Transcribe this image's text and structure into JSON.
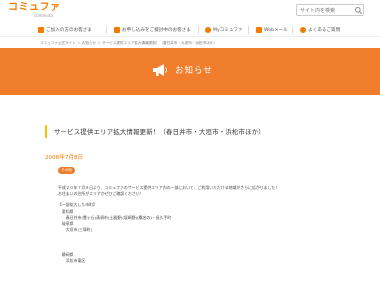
{
  "header": {
    "logo_text": "コミュファ",
    "logo_sub": "commufa",
    "search_placeholder": "サイト内を検索"
  },
  "nav": [
    {
      "label": "ご加入の方のお客さま"
    },
    {
      "label": "お申し込みをご検討中のお客さま"
    },
    {
      "label": "Myコミュファ"
    },
    {
      "label": "Webメール"
    },
    {
      "label": "よくあるご質問"
    }
  ],
  "breadcrumb": "コミュファ公式サイト ＞ お知らせ ＞ サービス提供エリア拡大情報更新！（春日井市・大垣市・浜松市ほか）",
  "banner": {
    "title": "お知らせ"
  },
  "article": {
    "headline": "サービス提供エリア拡大情報更新！（春日井市・大垣市・浜松市ほか）",
    "date": "2008年7月8日",
    "tag": "その他",
    "lines": [
      "平成２０年７月８日より、コミュファのサービス提供エリア内の一部において、ご利用いただける地域がさらに広がりました！",
      "お住まいの住所がエリアかぜひご確認ください！",
      "",
      "【一部拡大した市町】",
      "　愛知県",
      "　　春日井市(豊ヶ丘)清須市(土器野)(坂崎野)(桑名の)・長久手町",
      "　岐阜県",
      "　　大垣市(三塚町)",
      "",
      "",
      "",
      "　静岡県",
      "　　浜松市東区"
    ]
  },
  "colors": {
    "accent": "#f07d2b",
    "headline_bar": "#f2c400"
  }
}
